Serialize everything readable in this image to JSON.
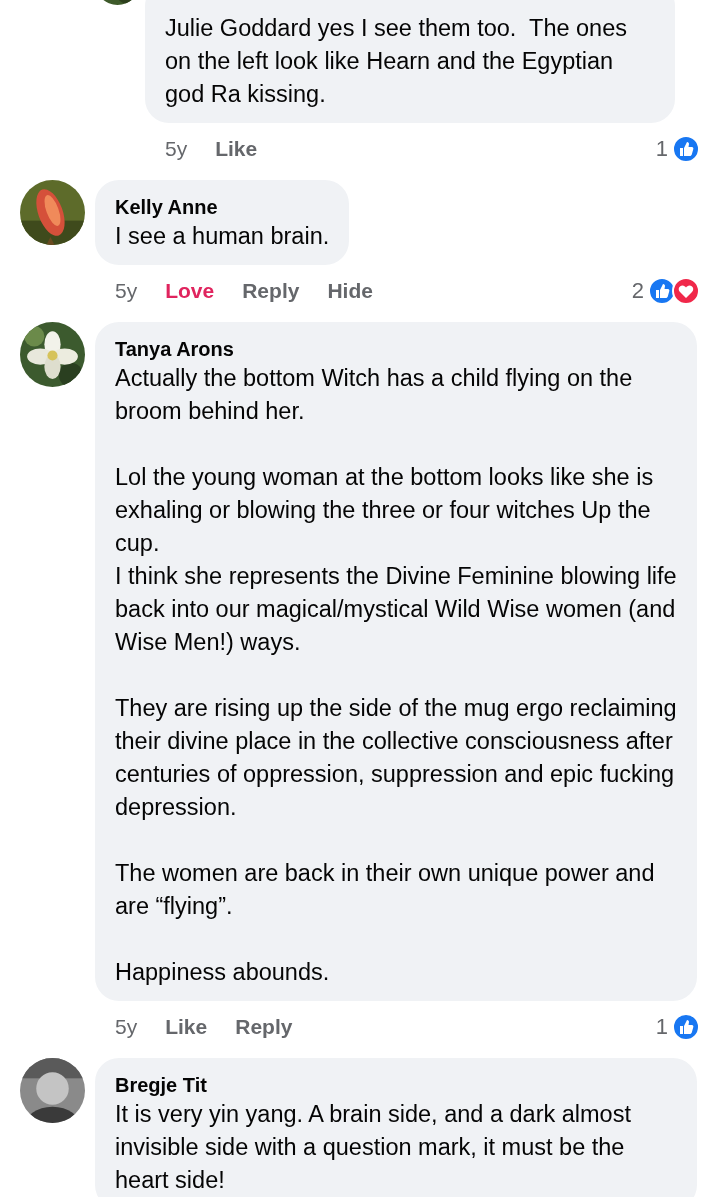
{
  "comments": [
    {
      "reply": true,
      "text": "Julie Goddard yes I see them too.  The ones on the left look like Hearn and the Egyptian god Ra kissing.",
      "actions": [
        {
          "kind": "time",
          "label": "5y"
        },
        {
          "kind": "action",
          "label": "Like",
          "selected": false
        }
      ],
      "reaction_count": "1",
      "reactions": [
        {
          "kind": "like"
        }
      ]
    },
    {
      "reply": false,
      "author": "Kelly Anne",
      "text": "I see a human brain.",
      "actions": [
        {
          "kind": "time",
          "label": "5y"
        },
        {
          "kind": "action",
          "label": "Love",
          "selected": true
        },
        {
          "kind": "action",
          "label": "Reply",
          "selected": false
        },
        {
          "kind": "action",
          "label": "Hide",
          "selected": false
        }
      ],
      "reaction_count": "2",
      "reactions": [
        {
          "kind": "like"
        },
        {
          "kind": "love"
        }
      ]
    },
    {
      "reply": false,
      "author": "Tanya Arons",
      "text": "Actually the bottom Witch has a child flying on the broom behind her.\n\nLol the young woman at the bottom looks like she is exhaling or blowing the three or four witches Up the cup.\nI think she represents the Divine Feminine blowing life back into our magical/mystical Wild Wise women (and Wise Men!) ways.\n\nThey are rising up the side of the mug ergo reclaiming their divine place in the collective consciousness after centuries of oppression, suppression and epic fucking  depression.\n\nThe women are back in their own unique power and are “flying”.\n\nHappiness abounds.",
      "actions": [
        {
          "kind": "time",
          "label": "5y"
        },
        {
          "kind": "action",
          "label": "Like",
          "selected": false
        },
        {
          "kind": "action",
          "label": "Reply",
          "selected": false
        }
      ],
      "reaction_count": "1",
      "reactions": [
        {
          "kind": "like"
        }
      ]
    },
    {
      "reply": false,
      "author": "Bregje Tit",
      "text": "It is very yin yang. A brain side, and a dark almost invisible side with a question mark, it must be the heart side!"
    }
  ]
}
